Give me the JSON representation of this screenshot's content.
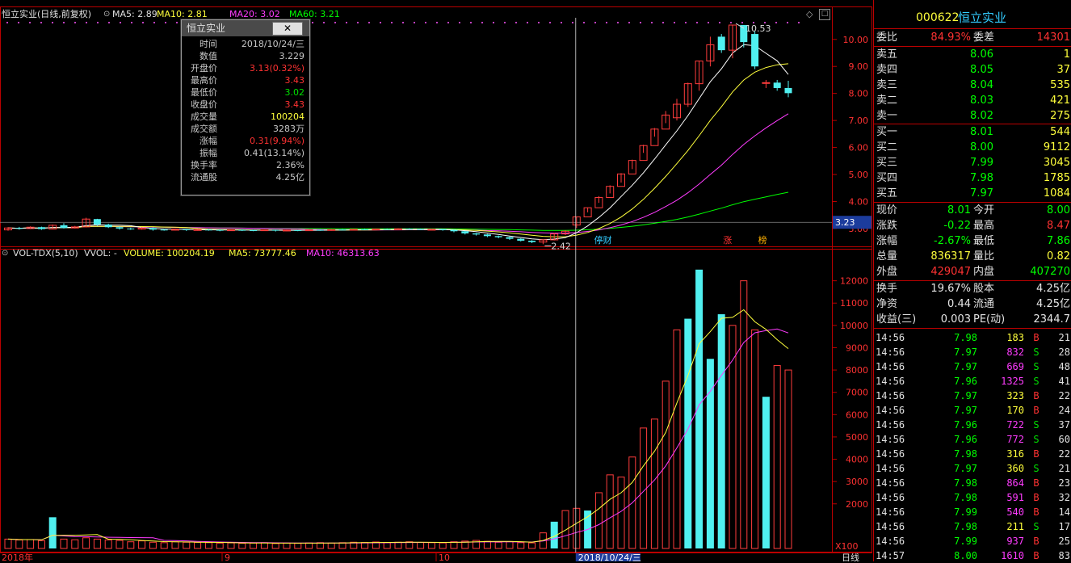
{
  "chart_header": {
    "name": "恒立实业(日线,前复权)",
    "ma5": "MA5: 2.89",
    "ma10": "MA10: 2.81",
    "ma20": "MA20: 3.02",
    "ma60": "MA60: 3.21"
  },
  "volume_header": {
    "name": "VOL-TDX(5,10)",
    "vvol": "VVOL: -",
    "volume": "VOLUME: 100204.19",
    "ma5": "MA5: 73777.46",
    "ma10": "MA10: 46313.63"
  },
  "price_axis": [
    "10.00",
    "9.00",
    "8.00",
    "7.00",
    "6.00",
    "5.00",
    "4.00",
    "3.00"
  ],
  "price_axis_current": "3.23",
  "volume_axis": [
    "12000",
    "11000",
    "10000",
    "9000",
    "8000",
    "7000",
    "6000",
    "5000",
    "4000",
    "3000",
    "2000"
  ],
  "volume_axis_unit": "X100",
  "date_axis": {
    "labels": [
      "2018年",
      "9",
      "10"
    ],
    "cursor_date": "2018/10/24/三",
    "period": "日线"
  },
  "annotations": {
    "high_marker": "10.53",
    "low_marker": "2.42",
    "tag_suspend": "停财",
    "tag_limit": "涨",
    "tag_rank": "榜"
  },
  "popup": {
    "title": "恒立实业",
    "close_label": "✕",
    "rows": [
      {
        "k": "时间",
        "v": "2018/10/24/三",
        "color": "#c8c8c8"
      },
      {
        "k": "数值",
        "v": "3.229",
        "color": "#c8c8c8"
      },
      {
        "k": "开盘价",
        "v": "3.13(0.32%)",
        "color": "#ff3232"
      },
      {
        "k": "最高价",
        "v": "3.43",
        "color": "#ff3232"
      },
      {
        "k": "最低价",
        "v": "3.02",
        "color": "#00e000"
      },
      {
        "k": "收盘价",
        "v": "3.43",
        "color": "#ff3232"
      },
      {
        "k": "成交量",
        "v": "100204",
        "color": "#ffff3c"
      },
      {
        "k": "成交额",
        "v": "3283万",
        "color": "#c8c8c8"
      },
      {
        "k": "涨幅",
        "v": "0.31(9.94%)",
        "color": "#ff3232"
      },
      {
        "k": "振幅",
        "v": "0.41(13.14%)",
        "color": "#c8c8c8"
      },
      {
        "k": "换手率",
        "v": "2.36%",
        "color": "#c8c8c8"
      },
      {
        "k": "流通股",
        "v": "4.25亿",
        "color": "#c8c8c8"
      }
    ]
  },
  "quote": {
    "code": "000622",
    "name": "恒立实业",
    "weibi_label": "委比",
    "weibi": "84.93%",
    "weicha_label": "委差",
    "weicha": "14301",
    "asks": [
      {
        "label": "卖五",
        "price": "8.06",
        "qty": "1"
      },
      {
        "label": "卖四",
        "price": "8.05",
        "qty": "37"
      },
      {
        "label": "卖三",
        "price": "8.04",
        "qty": "535"
      },
      {
        "label": "卖二",
        "price": "8.03",
        "qty": "421"
      },
      {
        "label": "卖一",
        "price": "8.02",
        "qty": "275"
      }
    ],
    "bids": [
      {
        "label": "买一",
        "price": "8.01",
        "qty": "544"
      },
      {
        "label": "买二",
        "price": "8.00",
        "qty": "9112"
      },
      {
        "label": "买三",
        "price": "7.99",
        "qty": "3045"
      },
      {
        "label": "买四",
        "price": "7.98",
        "qty": "1785"
      },
      {
        "label": "买五",
        "price": "7.97",
        "qty": "1084"
      }
    ],
    "stats": [
      {
        "l1": "现价",
        "v1": "8.01",
        "c1": "g",
        "l2": "今开",
        "v2": "8.00",
        "c2": "g"
      },
      {
        "l1": "涨跌",
        "v1": "-0.22",
        "c1": "g",
        "l2": "最高",
        "v2": "8.47",
        "c2": "r"
      },
      {
        "l1": "涨幅",
        "v1": "-2.67%",
        "c1": "g",
        "l2": "最低",
        "v2": "7.86",
        "c2": "g"
      },
      {
        "l1": "总量",
        "v1": "836317",
        "c1": "y",
        "l2": "量比",
        "v2": "0.82",
        "c2": "y"
      },
      {
        "l1": "外盘",
        "v1": "429047",
        "c1": "r",
        "l2": "内盘",
        "v2": "407270",
        "c2": "g"
      }
    ],
    "stats2": [
      {
        "l1": "换手",
        "v1": "19.67%",
        "c1": "w",
        "l2": "股本",
        "v2": "4.25亿",
        "c2": "w"
      },
      {
        "l1": "净资",
        "v1": "0.44",
        "c1": "w",
        "l2": "流通",
        "v2": "4.25亿",
        "c2": "w"
      },
      {
        "l1": "收益(三)",
        "v1": "0.003",
        "c1": "w",
        "l2": "PE(动)",
        "v2": "2344.7",
        "c2": "w"
      }
    ],
    "ticks": [
      {
        "t": "14:56",
        "p": "7.98",
        "v": "183",
        "s": "B",
        "n": "21"
      },
      {
        "t": "14:56",
        "p": "7.97",
        "v": "832",
        "s": "S",
        "n": "28"
      },
      {
        "t": "14:56",
        "p": "7.97",
        "v": "669",
        "s": "S",
        "n": "48"
      },
      {
        "t": "14:56",
        "p": "7.96",
        "v": "1325",
        "s": "S",
        "n": "41"
      },
      {
        "t": "14:56",
        "p": "7.97",
        "v": "323",
        "s": "B",
        "n": "22"
      },
      {
        "t": "14:56",
        "p": "7.97",
        "v": "170",
        "s": "B",
        "n": "24"
      },
      {
        "t": "14:56",
        "p": "7.96",
        "v": "722",
        "s": "S",
        "n": "37"
      },
      {
        "t": "14:56",
        "p": "7.96",
        "v": "772",
        "s": "S",
        "n": "60"
      },
      {
        "t": "14:56",
        "p": "7.98",
        "v": "316",
        "s": "B",
        "n": "22"
      },
      {
        "t": "14:56",
        "p": "7.97",
        "v": "360",
        "s": "S",
        "n": "21"
      },
      {
        "t": "14:56",
        "p": "7.98",
        "v": "864",
        "s": "B",
        "n": "23"
      },
      {
        "t": "14:56",
        "p": "7.98",
        "v": "591",
        "s": "B",
        "n": "32"
      },
      {
        "t": "14:56",
        "p": "7.99",
        "v": "540",
        "s": "B",
        "n": "14"
      },
      {
        "t": "14:56",
        "p": "7.98",
        "v": "211",
        "s": "S",
        "n": "17"
      },
      {
        "t": "14:56",
        "p": "7.99",
        "v": "937",
        "s": "B",
        "n": "25"
      },
      {
        "t": "14:57",
        "p": "8.00",
        "v": "1610",
        "s": "B",
        "n": "83"
      }
    ]
  },
  "candles": [
    [
      2.95,
      3.02,
      3.05,
      2.92
    ],
    [
      3.02,
      3.0,
      3.06,
      2.96
    ],
    [
      3.0,
      3.05,
      3.08,
      2.98
    ],
    [
      3.05,
      2.98,
      3.07,
      2.95
    ],
    [
      2.98,
      3.12,
      3.15,
      2.97
    ],
    [
      3.12,
      3.02,
      3.2,
      3.0
    ],
    [
      3.02,
      3.06,
      3.1,
      3.0
    ],
    [
      3.06,
      3.35,
      3.4,
      3.04
    ],
    [
      3.35,
      3.15,
      3.36,
      3.1
    ],
    [
      3.15,
      3.05,
      3.18,
      3.02
    ],
    [
      3.05,
      3.0,
      3.08,
      2.96
    ],
    [
      3.0,
      2.98,
      3.03,
      2.95
    ],
    [
      2.98,
      3.02,
      3.05,
      2.96
    ],
    [
      3.02,
      2.96,
      3.04,
      2.92
    ],
    [
      2.96,
      2.95,
      2.99,
      2.92
    ],
    [
      2.95,
      2.97,
      3.0,
      2.93
    ],
    [
      2.97,
      2.94,
      2.99,
      2.91
    ],
    [
      2.94,
      2.96,
      2.98,
      2.92
    ],
    [
      2.96,
      2.95,
      2.98,
      2.92
    ],
    [
      2.95,
      2.93,
      2.97,
      2.9
    ],
    [
      2.93,
      2.95,
      2.97,
      2.91
    ],
    [
      2.95,
      2.94,
      2.97,
      2.91
    ],
    [
      2.94,
      2.93,
      2.96,
      2.9
    ],
    [
      2.93,
      2.95,
      2.97,
      2.91
    ],
    [
      2.95,
      2.92,
      2.96,
      2.89
    ],
    [
      2.92,
      2.94,
      2.96,
      2.9
    ],
    [
      2.94,
      2.93,
      2.95,
      2.9
    ],
    [
      2.93,
      2.95,
      2.97,
      2.91
    ],
    [
      2.95,
      2.94,
      2.97,
      2.92
    ],
    [
      2.94,
      2.96,
      2.98,
      2.92
    ],
    [
      2.96,
      2.95,
      2.98,
      2.93
    ],
    [
      2.95,
      2.97,
      2.99,
      2.93
    ],
    [
      2.97,
      2.96,
      2.99,
      2.94
    ],
    [
      2.96,
      2.98,
      3.0,
      2.94
    ],
    [
      2.98,
      2.97,
      3.0,
      2.95
    ],
    [
      2.97,
      2.99,
      3.01,
      2.95
    ],
    [
      2.99,
      2.98,
      3.01,
      2.96
    ],
    [
      2.98,
      2.96,
      3.0,
      2.94
    ],
    [
      2.96,
      2.97,
      2.99,
      2.94
    ],
    [
      2.97,
      2.95,
      2.98,
      2.92
    ],
    [
      2.95,
      2.9,
      2.96,
      2.86
    ],
    [
      2.9,
      2.82,
      2.91,
      2.78
    ],
    [
      2.82,
      2.78,
      2.84,
      2.74
    ],
    [
      2.78,
      2.72,
      2.8,
      2.68
    ],
    [
      2.72,
      2.68,
      2.74,
      2.64
    ],
    [
      2.68,
      2.62,
      2.7,
      2.58
    ],
    [
      2.62,
      2.55,
      2.64,
      2.52
    ],
    [
      2.55,
      2.5,
      2.57,
      2.46
    ],
    [
      2.5,
      2.58,
      2.6,
      2.42
    ],
    [
      2.58,
      2.8,
      2.84,
      2.56
    ],
    [
      2.8,
      2.9,
      2.93,
      2.76
    ],
    [
      3.13,
      3.43,
      3.43,
      3.02
    ],
    [
      3.43,
      3.77,
      3.77,
      3.6
    ],
    [
      3.77,
      4.15,
      4.2,
      3.95
    ],
    [
      4.15,
      4.56,
      4.6,
      4.3
    ],
    [
      4.56,
      5.02,
      5.05,
      4.7
    ],
    [
      5.02,
      5.52,
      5.55,
      5.2
    ],
    [
      5.52,
      6.07,
      6.1,
      5.8
    ],
    [
      6.07,
      6.68,
      6.72,
      6.4
    ],
    [
      6.68,
      7.2,
      7.35,
      6.9
    ],
    [
      7.1,
      7.6,
      7.8,
      7.0
    ],
    [
      7.6,
      8.36,
      8.4,
      7.5
    ],
    [
      8.36,
      9.2,
      9.2,
      8.1
    ],
    [
      9.2,
      9.8,
      10.1,
      9.0
    ],
    [
      10.1,
      9.6,
      10.2,
      9.5
    ],
    [
      9.6,
      10.53,
      10.53,
      9.3
    ],
    [
      10.53,
      9.9,
      10.53,
      9.7
    ],
    [
      10.2,
      9.0,
      10.3,
      8.9
    ],
    [
      8.4,
      8.4,
      8.5,
      8.2
    ],
    [
      8.4,
      8.2,
      8.5,
      8.1
    ],
    [
      8.2,
      8.01,
      8.47,
      7.86
    ]
  ],
  "volumes": [
    420,
    380,
    400,
    350,
    1400,
    420,
    390,
    480,
    420,
    380,
    360,
    300,
    340,
    280,
    260,
    300,
    280,
    270,
    260,
    240,
    250,
    230,
    240,
    260,
    220,
    240,
    230,
    250,
    260,
    240,
    260,
    280,
    270,
    290,
    260,
    280,
    300,
    270,
    260,
    250,
    300,
    330,
    360,
    320,
    280,
    300,
    260,
    250,
    700,
    1200,
    1700,
    1800,
    1700,
    2500,
    3300,
    3200,
    4100,
    5400,
    5800,
    7500,
    9800,
    10300,
    12500,
    8500,
    10500,
    10000,
    12000,
    9800,
    6800,
    8200,
    8000
  ],
  "volumes_cyan": [
    4,
    49,
    52,
    61,
    62,
    63,
    64,
    68
  ],
  "ma_lines": {
    "ma5_color": "#ffffff",
    "ma10_color": "#ffff3c",
    "ma20_color": "#ff3cff",
    "ma60_color": "#00ff00"
  },
  "chart_data": {
    "type": "candlestick",
    "title": "恒立实业(日线,前复权)",
    "ylim_price": [
      2.4,
      10.8
    ],
    "ylim_volume": [
      0,
      13000
    ],
    "latest": {
      "date": "2018/10/24/三",
      "open": 3.13,
      "high": 3.43,
      "low": 3.02,
      "close": 3.43,
      "volume": 100204
    }
  }
}
